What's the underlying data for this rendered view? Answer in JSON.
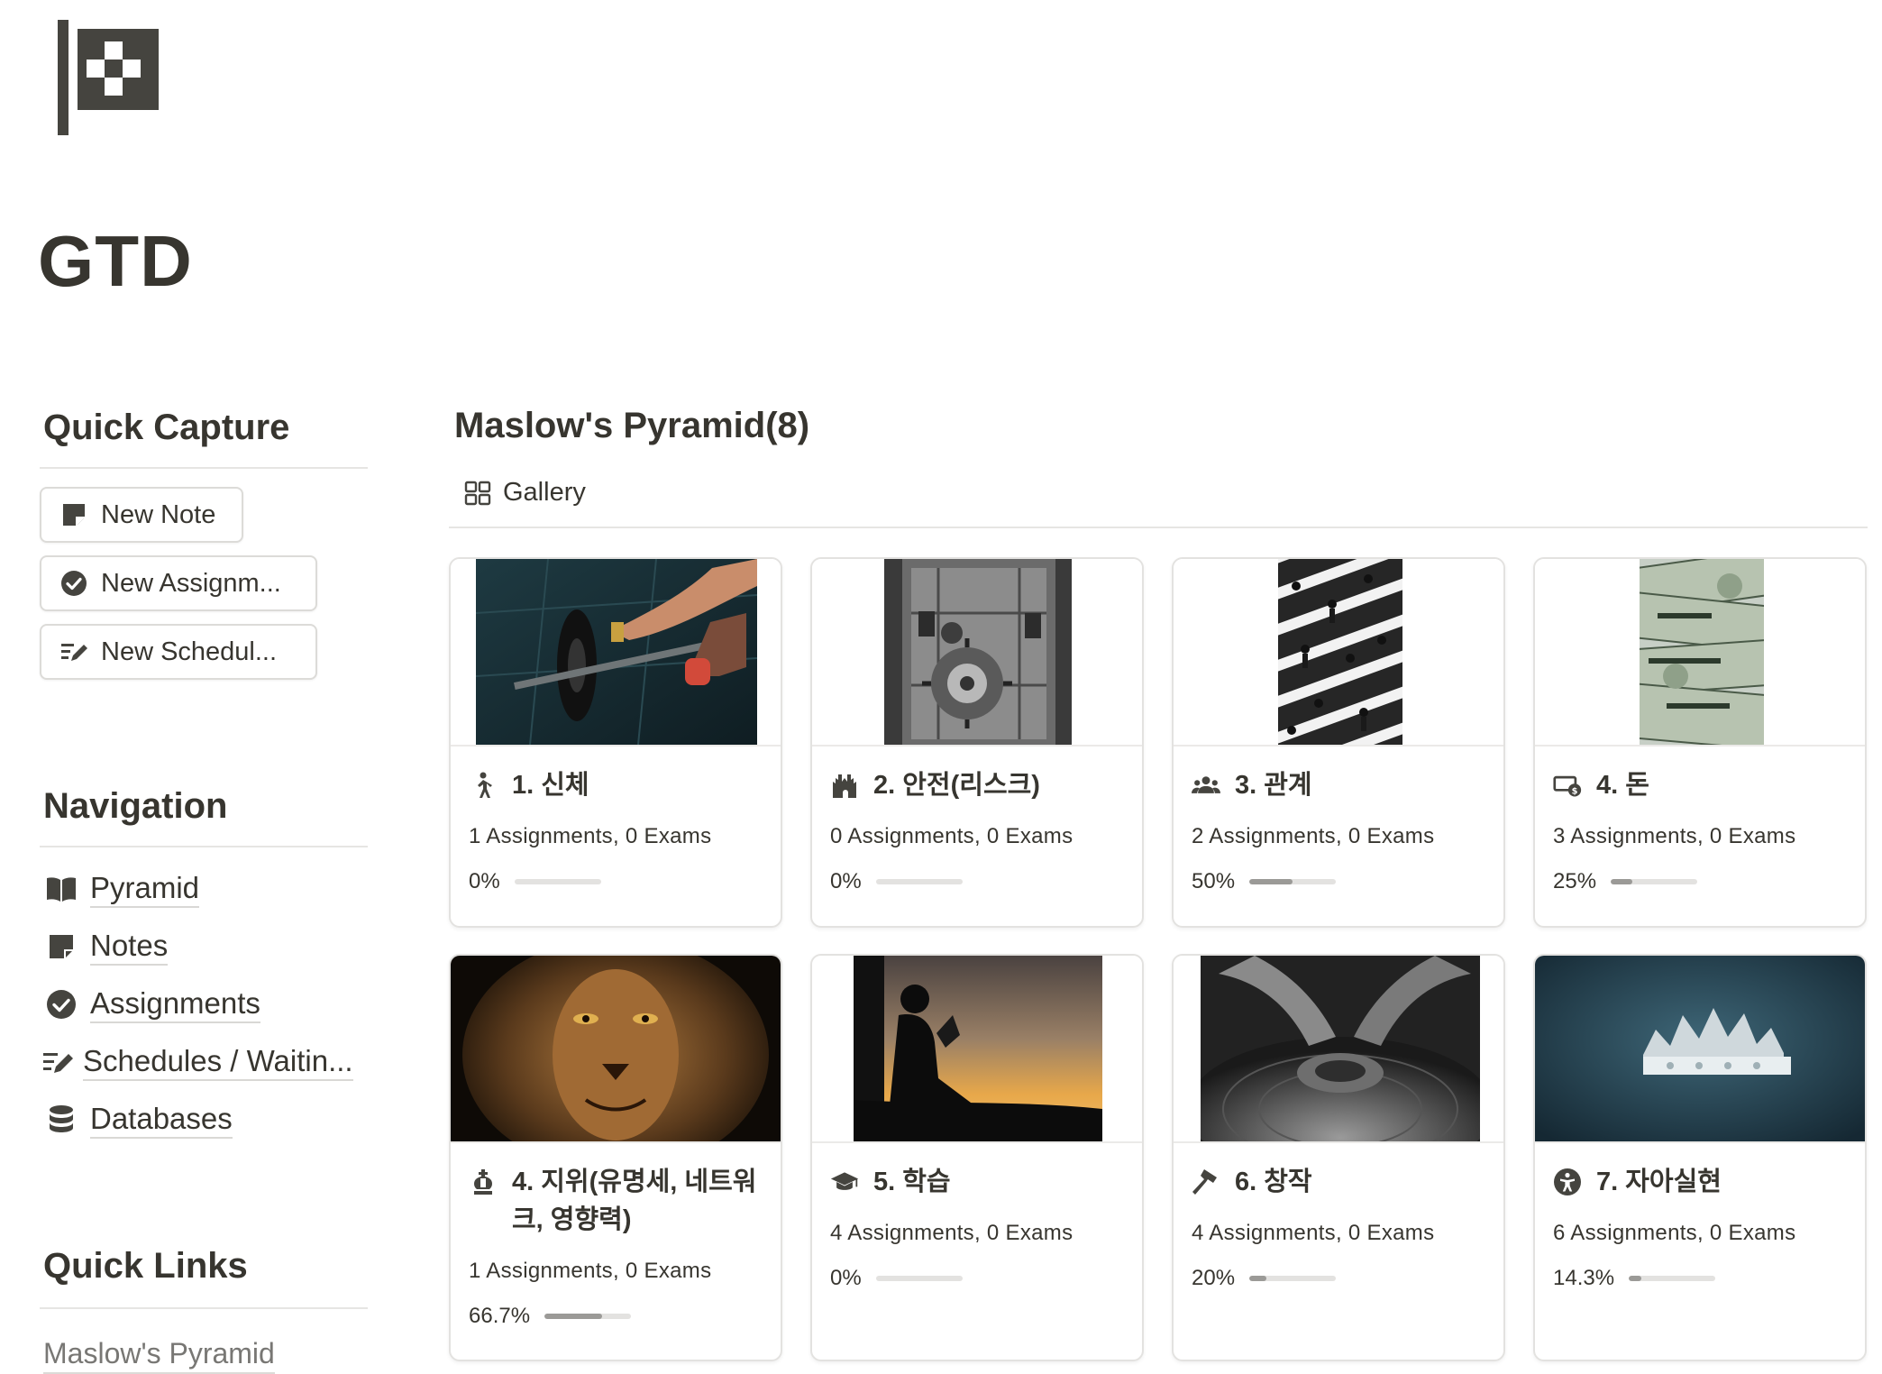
{
  "page": {
    "title": "GTD",
    "icon": "checkered-flag-icon"
  },
  "quick_capture": {
    "title": "Quick Capture",
    "buttons": [
      {
        "label": "New Note",
        "icon": "note-icon"
      },
      {
        "label": "New Assignm...",
        "icon": "check-circle-icon"
      },
      {
        "label": "New Schedul...",
        "icon": "list-edit-icon"
      }
    ]
  },
  "navigation": {
    "title": "Navigation",
    "items": [
      {
        "label": "Pyramid",
        "icon": "book-icon"
      },
      {
        "label": "Notes",
        "icon": "note-icon"
      },
      {
        "label": "Assignments",
        "icon": "check-circle-icon"
      },
      {
        "label": "Schedules / Waitin...",
        "icon": "list-edit-icon"
      },
      {
        "label": "Databases",
        "icon": "database-icon"
      }
    ]
  },
  "quick_links": {
    "title": "Quick Links",
    "items": [
      {
        "label": "Maslow's Pyramid"
      }
    ]
  },
  "gallery": {
    "title": "Maslow's Pyramid(8)",
    "view_label": "Gallery",
    "cards": [
      {
        "title": "1. 신체",
        "icon": "person-walking-icon",
        "cover": "barbell-lifting-photo",
        "meta": "1 Assignments, 0 Exams",
        "progress_label": "0%",
        "progress": 0
      },
      {
        "title": "2. 안전(리스크)",
        "icon": "castle-icon",
        "cover": "bank-vault-photo",
        "meta": "0 Assignments, 0 Exams",
        "progress_label": "0%",
        "progress": 0
      },
      {
        "title": "3. 관계",
        "icon": "people-group-icon",
        "cover": "crosswalk-crowd-photo",
        "meta": "2 Assignments, 0 Exams",
        "progress_label": "50%",
        "progress": 0.5
      },
      {
        "title": "4. 돈",
        "icon": "money-icon",
        "cover": "dollar-bills-photo",
        "meta": "3 Assignments, 0 Exams",
        "progress_label": "25%",
        "progress": 0.25
      },
      {
        "title": "4. 지위(유명세, 네트워크, 영향력)",
        "icon": "chess-king-icon",
        "cover": "lion-photo",
        "meta": "1 Assignments, 0 Exams",
        "progress_label": "66.7%",
        "progress": 0.667
      },
      {
        "title": "5. 학습",
        "icon": "graduation-cap-icon",
        "cover": "reading-silhouette-photo",
        "meta": "4 Assignments, 0 Exams",
        "progress_label": "0%",
        "progress": 0
      },
      {
        "title": "6. 창작",
        "icon": "hammer-icon",
        "cover": "pottery-wheel-photo",
        "meta": "4 Assignments, 0 Exams",
        "progress_label": "20%",
        "progress": 0.2
      },
      {
        "title": "7. 자아실현",
        "icon": "accessibility-icon",
        "cover": "crown-photo",
        "meta": "6 Assignments, 0 Exams",
        "progress_label": "14.3%",
        "progress": 0.143
      }
    ]
  }
}
